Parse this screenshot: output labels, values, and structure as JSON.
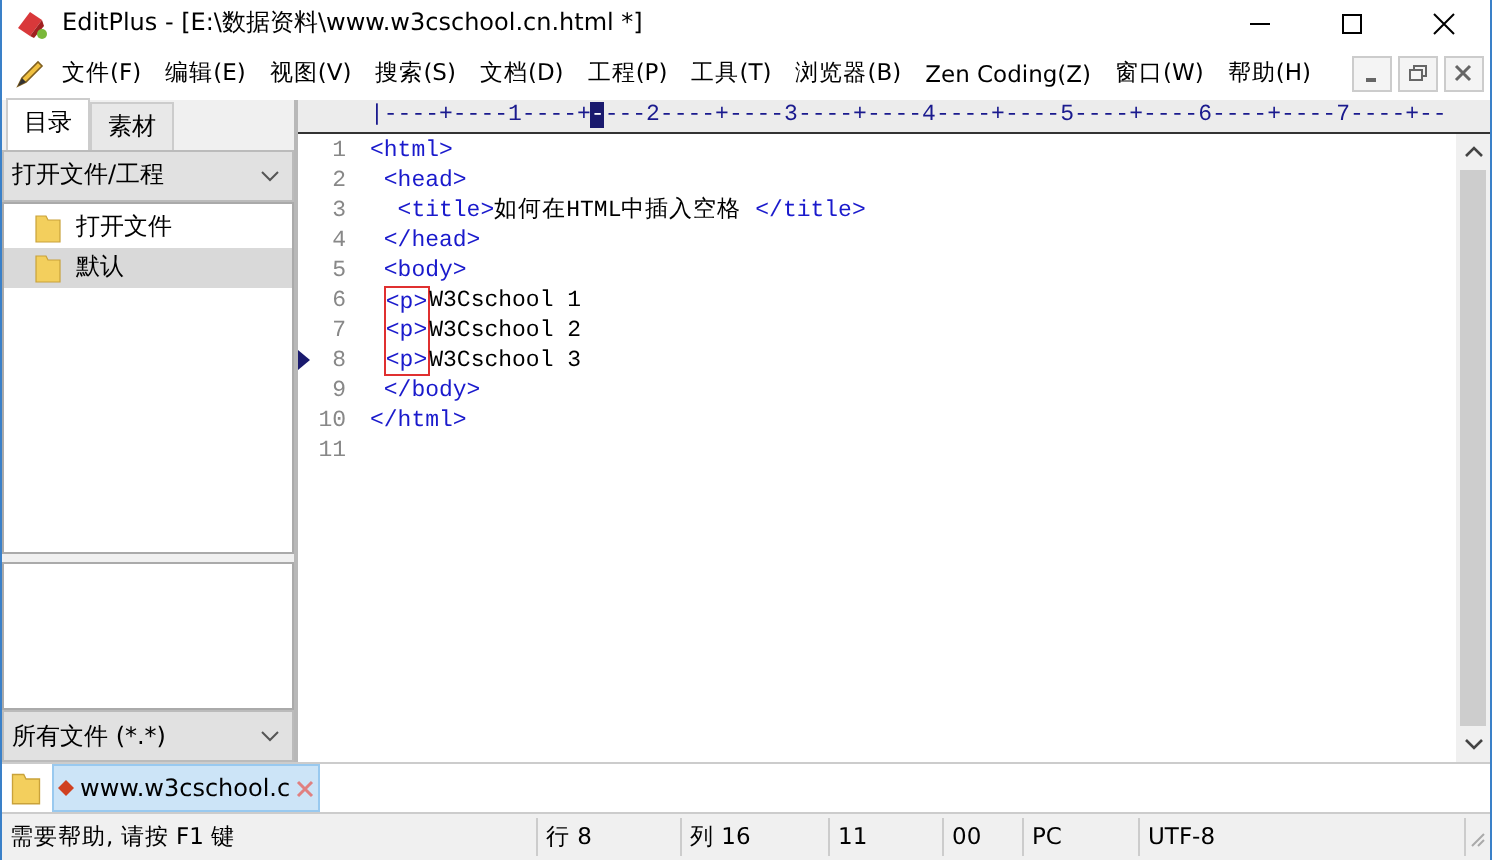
{
  "window": {
    "title": "EditPlus - [E:\\数据资料\\www.w3cschool.cn.html *]"
  },
  "menu": [
    "文件(F)",
    "编辑(E)",
    "视图(V)",
    "搜索(S)",
    "文档(D)",
    "工程(P)",
    "工具(T)",
    "浏览器(B)",
    "Zen Coding(Z)",
    "窗口(W)",
    "帮助(H)"
  ],
  "sidebar": {
    "tabs": [
      {
        "label": "目录",
        "selected": true
      },
      {
        "label": "素材",
        "selected": false
      }
    ],
    "project_select": "打开文件/工程",
    "items": [
      {
        "label": "打开文件",
        "selected": false
      },
      {
        "label": "默认",
        "selected": true
      }
    ],
    "filter_select": "所有文件 (*.*)"
  },
  "ruler": {
    "before": "|----+----1----+",
    "cursor": "-",
    "after": "---2----+----3----+----4----+----5----+----6----+----7----+--"
  },
  "lines": [
    {
      "number": "1",
      "current": false,
      "tokens": [
        {
          "kind": "tag",
          "text": "<html>"
        }
      ]
    },
    {
      "number": "2",
      "current": false,
      "tokens": [
        {
          "kind": "tag",
          "text": " <head>"
        }
      ]
    },
    {
      "number": "3",
      "current": false,
      "tokens": [
        {
          "kind": "tag",
          "text": "  <title>"
        },
        {
          "kind": "text",
          "text": "如何在HTML中插入空格 "
        },
        {
          "kind": "tag",
          "text": "</title>"
        }
      ]
    },
    {
      "number": "4",
      "current": false,
      "tokens": [
        {
          "kind": "tag",
          "text": " </head>"
        }
      ]
    },
    {
      "number": "5",
      "current": false,
      "tokens": [
        {
          "kind": "tag",
          "text": " <body>"
        }
      ]
    },
    {
      "number": "6",
      "current": false,
      "indented": true,
      "tokens": [
        {
          "kind": "tag",
          "text": "<p>",
          "boxed": true
        },
        {
          "kind": "text",
          "text": "W3Cschool 1"
        }
      ]
    },
    {
      "number": "7",
      "current": false,
      "indented": true,
      "tokens": [
        {
          "kind": "tag",
          "text": "<p>",
          "boxed": true
        },
        {
          "kind": "text",
          "text": "W3Cschool 2"
        }
      ]
    },
    {
      "number": "8",
      "current": true,
      "indented": true,
      "tokens": [
        {
          "kind": "tag",
          "text": "<p>",
          "boxed": true
        },
        {
          "kind": "text",
          "text": "W3Cschool 3"
        }
      ]
    },
    {
      "number": "9",
      "current": false,
      "tokens": [
        {
          "kind": "tag",
          "text": " </body>"
        }
      ]
    },
    {
      "number": "10",
      "current": false,
      "tokens": [
        {
          "kind": "tag",
          "text": "</html>"
        }
      ]
    },
    {
      "number": "11",
      "current": false
    }
  ],
  "document_tabs": [
    {
      "label": "www.w3cschool.c",
      "selected": true
    }
  ],
  "status_bar": [
    "需要帮助, 请按 F1 键",
    "行 8",
    "列 16",
    "11",
    "00",
    "PC",
    "UTF-8"
  ]
}
